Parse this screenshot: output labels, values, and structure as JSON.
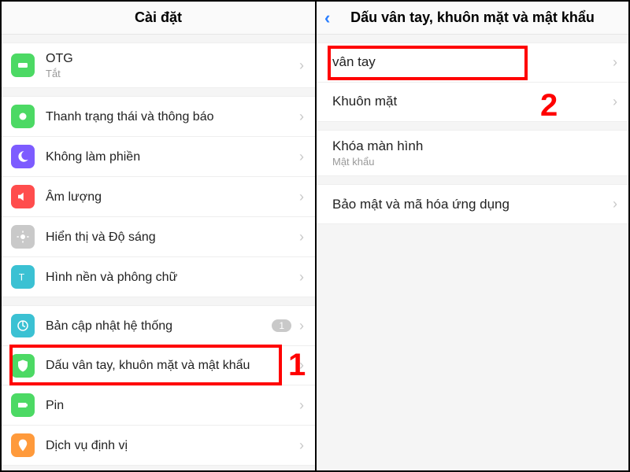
{
  "left": {
    "title": "Cài đặt",
    "items": [
      {
        "key": "otg",
        "label": "OTG",
        "sub": "Tắt",
        "icon": "otg-icon",
        "color": "c-otg"
      }
    ],
    "items2": [
      {
        "key": "status",
        "label": "Thanh trạng thái và thông báo",
        "icon": "bell-icon",
        "color": "c-status"
      },
      {
        "key": "dnd",
        "label": "Không làm phiền",
        "icon": "moon-icon",
        "color": "c-dnd"
      },
      {
        "key": "volume",
        "label": "Âm lượng",
        "icon": "volume-icon",
        "color": "c-vol"
      },
      {
        "key": "brightness",
        "label": "Hiển thị và Độ sáng",
        "icon": "brightness-icon",
        "color": "c-bright"
      },
      {
        "key": "font",
        "label": "Hình nền và phông chữ",
        "icon": "font-icon",
        "color": "c-font"
      }
    ],
    "items3": [
      {
        "key": "update",
        "label": "Bản cập nhật hệ thống",
        "icon": "update-icon",
        "color": "c-update",
        "badge": "1"
      },
      {
        "key": "fingerprint",
        "label": "Dấu vân tay, khuôn mặt và mật khẩu",
        "icon": "shield-icon",
        "color": "c-finger"
      },
      {
        "key": "pin",
        "label": "Pin",
        "icon": "battery-icon",
        "color": "c-pin"
      },
      {
        "key": "location",
        "label": "Dịch vụ định vị",
        "icon": "location-icon",
        "color": "c-loc"
      }
    ]
  },
  "right": {
    "title": "Dấu vân tay, khuôn mặt và mật khẩu",
    "groupA": [
      {
        "key": "vantay",
        "label": "vân tay"
      },
      {
        "key": "face",
        "label": "Khuôn mặt"
      }
    ],
    "groupB": [
      {
        "key": "lockscreen",
        "label": "Khóa màn hình",
        "sub": "Mật khẩu"
      }
    ],
    "groupC": [
      {
        "key": "appenc",
        "label": "Bảo mật và mã hóa ứng dụng"
      }
    ]
  },
  "callouts": {
    "one": "1",
    "two": "2"
  }
}
